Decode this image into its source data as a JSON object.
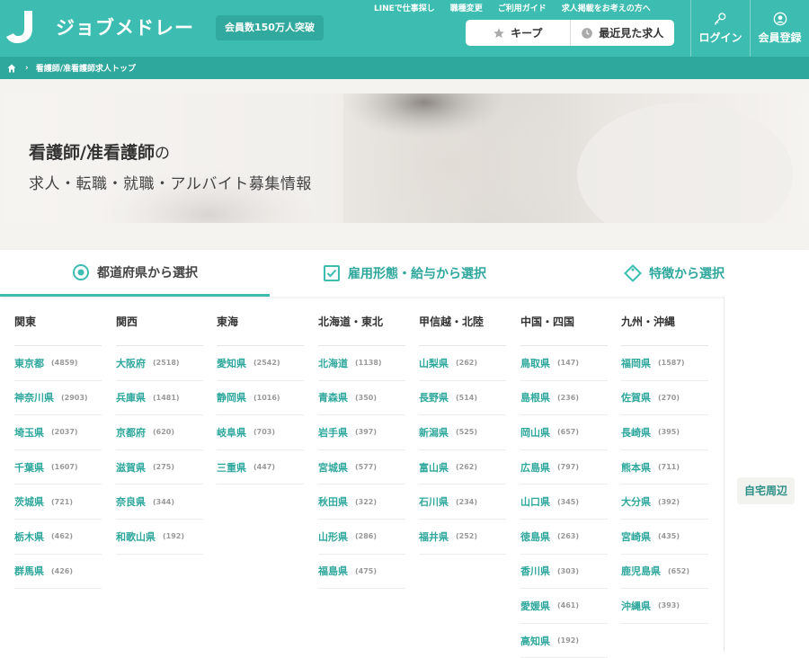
{
  "header": {
    "logo_text": "ジョブメドレー",
    "member_badge": "会員数150万人突破",
    "top_links": [
      "LINEで仕事探し",
      "職種変更",
      "ご利用ガイド",
      "求人掲載をお考えの方へ"
    ],
    "keep_label": "キープ",
    "recent_label": "最近見た求人",
    "login_label": "ログイン",
    "register_label": "会員登録",
    "brand_color": "#3dbdb1"
  },
  "breadcrumb": {
    "current": "看護師/准看護師求人トップ"
  },
  "hero": {
    "title_strong": "看護師/准看護師",
    "title_suffix": "の",
    "subtitle": "求人・転職・就職・アルバイト募集情報"
  },
  "tabs": [
    {
      "label": "都道府県から選択",
      "icon": "map-pin-icon"
    },
    {
      "label": "雇用形態・給与から選択",
      "icon": "checkbox-icon"
    },
    {
      "label": "特徴から選択",
      "icon": "tag-icon"
    }
  ],
  "regions": [
    {
      "name": "関東",
      "prefectures": [
        {
          "name": "東京都",
          "count": "(4859)"
        },
        {
          "name": "神奈川県",
          "count": "(2903)"
        },
        {
          "name": "埼玉県",
          "count": "(2037)"
        },
        {
          "name": "千葉県",
          "count": "(1607)"
        },
        {
          "name": "茨城県",
          "count": "(721)"
        },
        {
          "name": "栃木県",
          "count": "(462)"
        },
        {
          "name": "群馬県",
          "count": "(426)"
        }
      ]
    },
    {
      "name": "関西",
      "prefectures": [
        {
          "name": "大阪府",
          "count": "(2518)"
        },
        {
          "name": "兵庫県",
          "count": "(1481)"
        },
        {
          "name": "京都府",
          "count": "(620)"
        },
        {
          "name": "滋賀県",
          "count": "(275)"
        },
        {
          "name": "奈良県",
          "count": "(344)"
        },
        {
          "name": "和歌山県",
          "count": "(192)"
        }
      ]
    },
    {
      "name": "東海",
      "prefectures": [
        {
          "name": "愛知県",
          "count": "(2542)"
        },
        {
          "name": "静岡県",
          "count": "(1016)"
        },
        {
          "name": "岐阜県",
          "count": "(703)"
        },
        {
          "name": "三重県",
          "count": "(447)"
        }
      ]
    },
    {
      "name": "北海道・東北",
      "prefectures": [
        {
          "name": "北海道",
          "count": "(1138)"
        },
        {
          "name": "青森県",
          "count": "(350)"
        },
        {
          "name": "岩手県",
          "count": "(397)"
        },
        {
          "name": "宮城県",
          "count": "(577)"
        },
        {
          "name": "秋田県",
          "count": "(322)"
        },
        {
          "name": "山形県",
          "count": "(286)"
        },
        {
          "name": "福島県",
          "count": "(475)"
        }
      ]
    },
    {
      "name": "甲信越・北陸",
      "prefectures": [
        {
          "name": "山梨県",
          "count": "(262)"
        },
        {
          "name": "長野県",
          "count": "(514)"
        },
        {
          "name": "新潟県",
          "count": "(525)"
        },
        {
          "name": "富山県",
          "count": "(262)"
        },
        {
          "name": "石川県",
          "count": "(234)"
        },
        {
          "name": "福井県",
          "count": "(252)"
        }
      ]
    },
    {
      "name": "中国・四国",
      "prefectures": [
        {
          "name": "鳥取県",
          "count": "(147)"
        },
        {
          "name": "島根県",
          "count": "(236)"
        },
        {
          "name": "岡山県",
          "count": "(657)"
        },
        {
          "name": "広島県",
          "count": "(797)"
        },
        {
          "name": "山口県",
          "count": "(345)"
        },
        {
          "name": "徳島県",
          "count": "(263)"
        },
        {
          "name": "香川県",
          "count": "(303)"
        },
        {
          "name": "愛媛県",
          "count": "(461)"
        },
        {
          "name": "高知県",
          "count": "(192)"
        }
      ]
    },
    {
      "name": "九州・沖縄",
      "prefectures": [
        {
          "name": "福岡県",
          "count": "(1587)"
        },
        {
          "name": "佐賀県",
          "count": "(270)"
        },
        {
          "name": "長崎県",
          "count": "(395)"
        },
        {
          "name": "熊本県",
          "count": "(711)"
        },
        {
          "name": "大分県",
          "count": "(392)"
        },
        {
          "name": "宮崎県",
          "count": "(435)"
        },
        {
          "name": "鹿児島県",
          "count": "(652)"
        },
        {
          "name": "沖縄県",
          "count": "(393)"
        }
      ]
    }
  ],
  "side": {
    "home_area_label": "自宅周辺"
  }
}
